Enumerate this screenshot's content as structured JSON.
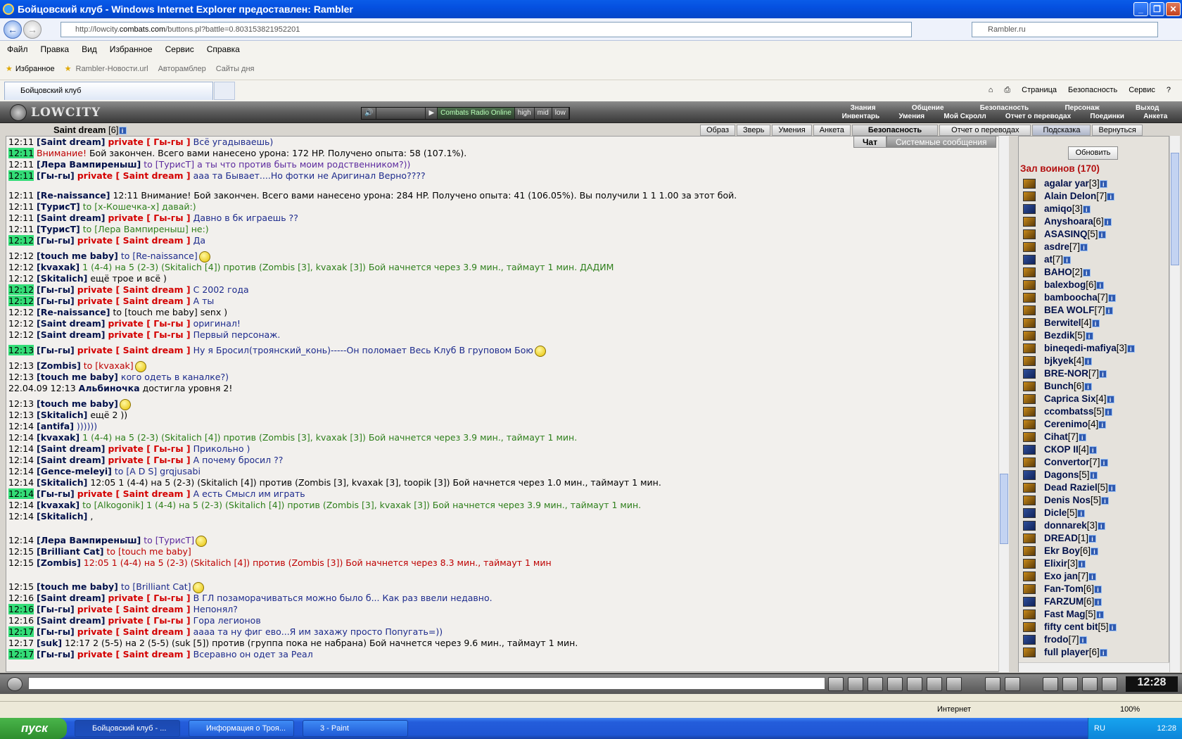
{
  "window": {
    "title": "Бойцовский клуб - Windows Internet Explorer предоставлен: Rambler"
  },
  "address": {
    "url_prefix": "http://lowcity.",
    "url_host": "combats.com",
    "url_rest": "/buttons.pl?battle=0.803153821952201",
    "search_placeholder": "Rambler.ru"
  },
  "menu": [
    "Файл",
    "Правка",
    "Вид",
    "Избранное",
    "Сервис",
    "Справка"
  ],
  "favbar": {
    "favorites": "Избранное",
    "links": [
      "Rambler-Новости.url",
      "Авторамблер",
      "Сайты дня"
    ]
  },
  "tab": {
    "title": "Бойцовский клуб"
  },
  "commands": [
    "Страница",
    "Безопасность",
    "Сервис"
  ],
  "game": {
    "logo": "LOWCITY",
    "radio": {
      "station": "Combats Radio Online",
      "q1": "high",
      "q2": "mid",
      "q3": "low"
    },
    "menu_top": [
      "Знания",
      "Общение",
      "Безопасность",
      "Персонаж",
      "Выход"
    ],
    "menu_bottom": [
      "Инвентарь",
      "Умения",
      "Мой Скролл",
      "Отчет о переводах",
      "Поединки",
      "Анкета"
    ],
    "user": {
      "name": "Saint dream",
      "level": "[6]"
    },
    "tabs": [
      "Образ",
      "Зверь",
      "Умения",
      "Анкета",
      "Безопасность",
      "Отчет о переводах",
      "Подсказка",
      "Вернуться"
    ],
    "chat_tabs": {
      "chat": "Чат",
      "system": "Системные сообщения"
    },
    "refresh": "Обновить",
    "room": "Зал воинов (170)",
    "clock": "12:28"
  },
  "chat": [
    {
      "t": "12:11",
      "h": false,
      "parts": [
        [
          "nk",
          "[Saint dream]"
        ],
        [
          "pv",
          "private [ Гы-гы ]"
        ],
        [
          "msg",
          "Всё угадываешь)"
        ]
      ]
    },
    {
      "t": "12:11",
      "h": true,
      "parts": [
        [
          "sys",
          "Внимание!"
        ],
        [
          "blk",
          "Бой закончен. Всего вами нанесено урона: 172 HP. Получено опыта: 58 (107.1%)."
        ]
      ]
    },
    {
      "t": "12:11",
      "h": false,
      "parts": [
        [
          "nk",
          "[Лера Вампиреныш]"
        ],
        [
          "to",
          "to [ТурисТ] а ты что против быть моим родственником?))"
        ]
      ]
    },
    {
      "t": "12:11",
      "h": true,
      "parts": [
        [
          "nk",
          "[Гы-гы]"
        ],
        [
          "pv",
          "private [ Saint dream ]"
        ],
        [
          "msg",
          "ааа та Бывает....Но фотки не Аригинал Верно????"
        ]
      ]
    },
    {
      "t": "12:11",
      "h": false,
      "gap": true,
      "parts": [
        [
          "nk",
          "[Re-naissance]"
        ],
        [
          "blk",
          "12:11 Внимание! Бой закончен. Всего вами нанесено урона: 284 HP. Получено опыта: 41 (106.05%). Вы получили 1 1 1.00 за этот бой."
        ]
      ]
    },
    {
      "t": "12:11",
      "h": false,
      "parts": [
        [
          "nk",
          "[ТурисТ]"
        ],
        [
          "grn",
          "to [х-Кошечка-х] давай:)"
        ]
      ]
    },
    {
      "t": "12:11",
      "h": false,
      "parts": [
        [
          "nk",
          "[Saint dream]"
        ],
        [
          "pv",
          "private [ Гы-гы ]"
        ],
        [
          "msg",
          "Давно в бк играешь ??"
        ]
      ]
    },
    {
      "t": "12:11",
      "h": false,
      "parts": [
        [
          "nk",
          "[ТурисТ]"
        ],
        [
          "grn",
          "to [Лера Вампиреныш] не:)"
        ]
      ]
    },
    {
      "t": "12:12",
      "h": true,
      "parts": [
        [
          "nk",
          "[Гы-гы]"
        ],
        [
          "pv",
          "private [ Saint dream ]"
        ],
        [
          "msg",
          "Да"
        ]
      ]
    },
    {
      "t": "12:12",
      "h": false,
      "tall": true,
      "parts": [
        [
          "nk",
          "[touch me baby]"
        ],
        [
          "msg",
          "to [Re-naissance]"
        ]
      ]
    },
    {
      "t": "12:12",
      "h": false,
      "parts": [
        [
          "nk",
          "[kvaxak]"
        ],
        [
          "grn",
          "1 (4-4) на 5 (2-3) (Skitalich [4]) против (Zombis [3], kvaxak [3]) Бой начнется через 3.9 мин., таймаут 1 мин. ДАДИМ"
        ]
      ]
    },
    {
      "t": "12:12",
      "h": false,
      "parts": [
        [
          "nk",
          "[Skitalich]"
        ],
        [
          "blk",
          "ещё трое и всё )"
        ]
      ]
    },
    {
      "t": "12:12",
      "h": true,
      "parts": [
        [
          "nk",
          "[Гы-гы]"
        ],
        [
          "pv",
          "private [ Saint dream ]"
        ],
        [
          "msg",
          "С 2002 года"
        ]
      ]
    },
    {
      "t": "12:12",
      "h": true,
      "parts": [
        [
          "nk",
          "[Гы-гы]"
        ],
        [
          "pv",
          "private [ Saint dream ]"
        ],
        [
          "msg",
          "А ты"
        ]
      ]
    },
    {
      "t": "12:12",
      "h": false,
      "parts": [
        [
          "nk",
          "[Re-naissance]"
        ],
        [
          "blk",
          "to [touch me baby] senx )"
        ]
      ]
    },
    {
      "t": "12:12",
      "h": false,
      "parts": [
        [
          "nk",
          "[Saint dream]"
        ],
        [
          "pv",
          "private [ Гы-гы ]"
        ],
        [
          "msg",
          "оригинал!"
        ]
      ]
    },
    {
      "t": "12:12",
      "h": false,
      "parts": [
        [
          "nk",
          "[Saint dream]"
        ],
        [
          "pv",
          "private [ Гы-гы ]"
        ],
        [
          "msg",
          "Первый персонаж."
        ]
      ]
    },
    {
      "t": "12:13",
      "h": true,
      "tall": true,
      "parts": [
        [
          "nk",
          "[Гы-гы]"
        ],
        [
          "pv",
          "private [ Saint dream ]"
        ],
        [
          "msg",
          "Ну я Бросил(троянский_конь)-----Он поломает Весь Клуб В груповом Бою"
        ]
      ]
    },
    {
      "t": "12:13",
      "h": false,
      "tall": true,
      "parts": [
        [
          "nk",
          "[Zombis]"
        ],
        [
          "sys",
          "to [kvaxak]"
        ]
      ]
    },
    {
      "t": "12:13",
      "h": false,
      "parts": [
        [
          "nk",
          "[touch me baby]"
        ],
        [
          "msg",
          "кого одеть в каналке?)"
        ]
      ]
    },
    {
      "t": "22.04.09 12:13",
      "h": false,
      "parts": [
        [
          "nk",
          "Альбиночка"
        ],
        [
          "blk",
          "достигла уровня 2!"
        ]
      ]
    },
    {
      "t": "12:13",
      "h": false,
      "tall": true,
      "parts": [
        [
          "nk",
          "[touch me baby]"
        ]
      ]
    },
    {
      "t": "12:13",
      "h": false,
      "parts": [
        [
          "nk",
          "[Skitalich]"
        ],
        [
          "blk",
          "ещё 2 ))"
        ]
      ]
    },
    {
      "t": "12:14",
      "h": false,
      "parts": [
        [
          "nk",
          "[antifa]"
        ],
        [
          "msg",
          "))))))"
        ]
      ]
    },
    {
      "t": "12:14",
      "h": false,
      "parts": [
        [
          "nk",
          "[kvaxak]"
        ],
        [
          "grn",
          "1 (4-4) на 5 (2-3) (Skitalich [4]) против (Zombis [3], kvaxak [3]) Бой начнется через 3.9 мин., таймаут 1 мин."
        ]
      ]
    },
    {
      "t": "12:14",
      "h": false,
      "parts": [
        [
          "nk",
          "[Saint dream]"
        ],
        [
          "pv",
          "private [ Гы-гы ]"
        ],
        [
          "msg",
          "Прикольно )"
        ]
      ]
    },
    {
      "t": "12:14",
      "h": false,
      "parts": [
        [
          "nk",
          "[Saint dream]"
        ],
        [
          "pv",
          "private [ Гы-гы ]"
        ],
        [
          "msg",
          "А почему бросил ??"
        ]
      ]
    },
    {
      "t": "12:14",
      "h": false,
      "parts": [
        [
          "nk",
          "[Gence-meleyi]"
        ],
        [
          "msg",
          "to [A D S] grqjusabi"
        ]
      ]
    },
    {
      "t": "12:14",
      "h": false,
      "parts": [
        [
          "nk",
          "[Skitalich]"
        ],
        [
          "blk",
          "12:05 1 (4-4) на 5 (2-3) (Skitalich [4]) против (Zombis [3], kvaxak [3], toopik [3]) Бой начнется через 1.0 мин., таймаут 1 мин."
        ]
      ]
    },
    {
      "t": "12:14",
      "h": true,
      "parts": [
        [
          "nk",
          "[Гы-гы]"
        ],
        [
          "pv",
          "private [ Saint dream ]"
        ],
        [
          "msg",
          "А есть Смысл им играть"
        ]
      ]
    },
    {
      "t": "12:14",
      "h": false,
      "parts": [
        [
          "nk",
          "[kvaxak]"
        ],
        [
          "grn",
          "to [Alkogonik] 1 (4-4) на 5 (2-3) (Skitalich [4]) против (Zombis [3], kvaxak [3]) Бой начнется через 3.9 мин., таймаут 1 мин."
        ]
      ]
    },
    {
      "t": "12:14",
      "h": false,
      "parts": [
        [
          "nk",
          "[Skitalich]"
        ],
        [
          "blk",
          ","
        ]
      ]
    },
    {
      "t": "12:14",
      "h": false,
      "gap": true,
      "tall": true,
      "parts": [
        [
          "nk",
          "[Лера Вампиреныш]"
        ],
        [
          "to",
          "to [ТурисТ]"
        ]
      ]
    },
    {
      "t": "12:15",
      "h": false,
      "parts": [
        [
          "nk",
          "[Brilliant Cat]"
        ],
        [
          "sys",
          "to [touch me baby]"
        ]
      ]
    },
    {
      "t": "12:15",
      "h": false,
      "parts": [
        [
          "nk",
          "[Zombis]"
        ],
        [
          "sys",
          "12:05 1 (4-4) на 5 (2-3) (Skitalich [4]) против (Zombis [3]) Бой начнется через 8.3 мин., таймаут 1 мин"
        ]
      ]
    },
    {
      "t": "12:15",
      "h": false,
      "gap": true,
      "tall": true,
      "parts": [
        [
          "nk",
          "[touch me baby]"
        ],
        [
          "msg",
          "to [Brilliant Cat]"
        ]
      ]
    },
    {
      "t": "12:16",
      "h": false,
      "parts": [
        [
          "nk",
          "[Saint dream]"
        ],
        [
          "pv",
          "private [ Гы-гы ]"
        ],
        [
          "msg",
          "В ГЛ позаморачиваться можно было б... Как раз ввели недавно."
        ]
      ]
    },
    {
      "t": "12:16",
      "h": true,
      "parts": [
        [
          "nk",
          "[Гы-гы]"
        ],
        [
          "pv",
          "private [ Saint dream ]"
        ],
        [
          "msg",
          "Непонял?"
        ]
      ]
    },
    {
      "t": "12:16",
      "h": false,
      "parts": [
        [
          "nk",
          "[Saint dream]"
        ],
        [
          "pv",
          "private [ Гы-гы ]"
        ],
        [
          "msg",
          "Гора легионов"
        ]
      ]
    },
    {
      "t": "12:17",
      "h": true,
      "parts": [
        [
          "nk",
          "[Гы-гы]"
        ],
        [
          "pv",
          "private [ Saint dream ]"
        ],
        [
          "msg",
          "аааа та ну фиг ево...Я им захажу просто Попугать=))"
        ]
      ]
    },
    {
      "t": "12:17",
      "h": false,
      "parts": [
        [
          "nk",
          "[suk]"
        ],
        [
          "blk",
          "12:17 2 (5-5) на 2 (5-5) (suk [5]) против (группа пока не набрана) Бой начнется через 9.6 мин., таймаут 1 мин."
        ]
      ]
    },
    {
      "t": "12:17",
      "h": true,
      "parts": [
        [
          "nk",
          "[Гы-гы]"
        ],
        [
          "pv",
          "private [ Saint dream ]"
        ],
        [
          "msg",
          "Всеравно он одет за Реал"
        ]
      ]
    }
  ],
  "players": [
    {
      "n": "agalar yar",
      "l": "[3]",
      "b": false
    },
    {
      "n": "Alain Delon",
      "l": "[7]",
      "b": false
    },
    {
      "n": "amiqo",
      "l": "[3]",
      "b": true
    },
    {
      "n": "Anyshoara",
      "l": "[6]",
      "b": false
    },
    {
      "n": "ASASINQ",
      "l": "[5]",
      "b": false
    },
    {
      "n": "asdre",
      "l": "[7]",
      "b": false
    },
    {
      "n": "at",
      "l": "[7]",
      "b": true
    },
    {
      "n": "BAHO",
      "l": "[2]",
      "b": false
    },
    {
      "n": "balexbog",
      "l": "[6]",
      "b": false
    },
    {
      "n": "bamboocha",
      "l": "[7]",
      "b": false
    },
    {
      "n": "BEA WOLF",
      "l": "[7]",
      "b": false
    },
    {
      "n": "Berwitel",
      "l": "[4]",
      "b": false
    },
    {
      "n": "Bezdik",
      "l": "[5]",
      "b": false
    },
    {
      "n": "bineqedi-mafiya",
      "l": "[3]",
      "b": false
    },
    {
      "n": "bjkyek",
      "l": "[4]",
      "b": false
    },
    {
      "n": "BRE-NOR",
      "l": "[7]",
      "b": true
    },
    {
      "n": "Bunch",
      "l": "[6]",
      "b": false
    },
    {
      "n": "Caprica Six",
      "l": "[4]",
      "b": false
    },
    {
      "n": "ccombatss",
      "l": "[5]",
      "b": false
    },
    {
      "n": "Cerenimo",
      "l": "[4]",
      "b": false
    },
    {
      "n": "Cihat",
      "l": "[7]",
      "b": false
    },
    {
      "n": "СКОР II",
      "l": "[4]",
      "b": true
    },
    {
      "n": "Convertor",
      "l": "[7]",
      "b": false
    },
    {
      "n": "Dagons",
      "l": "[5]",
      "b": true
    },
    {
      "n": "Dead Raziel",
      "l": "[5]",
      "b": false
    },
    {
      "n": "Denis Nos",
      "l": "[5]",
      "b": false
    },
    {
      "n": "Dicle",
      "l": "[5]",
      "b": true
    },
    {
      "n": "donnarek",
      "l": "[3]",
      "b": true
    },
    {
      "n": "DREAD",
      "l": "[1]",
      "b": false
    },
    {
      "n": "Ekr Boy",
      "l": "[6]",
      "b": false
    },
    {
      "n": "Elixir",
      "l": "[3]",
      "b": false
    },
    {
      "n": "Exo jan",
      "l": "[7]",
      "b": false
    },
    {
      "n": "Fan-Tom",
      "l": "[6]",
      "b": false
    },
    {
      "n": "FARZUM",
      "l": "[6]",
      "b": true
    },
    {
      "n": "Fast Mag",
      "l": "[5]",
      "b": false
    },
    {
      "n": "fifty cent bit",
      "l": "[5]",
      "b": false
    },
    {
      "n": "frodo",
      "l": "[7]",
      "b": true
    },
    {
      "n": "full player",
      "l": "[6]",
      "b": false
    }
  ],
  "status": {
    "zone": "Интернет",
    "zoom": "100%"
  },
  "taskbar": {
    "start": "пуск",
    "tasks": [
      "Бойцовский клуб - ...",
      "Информация о Троя...",
      "3 - Paint"
    ],
    "lang": "RU",
    "time": "12:28"
  }
}
